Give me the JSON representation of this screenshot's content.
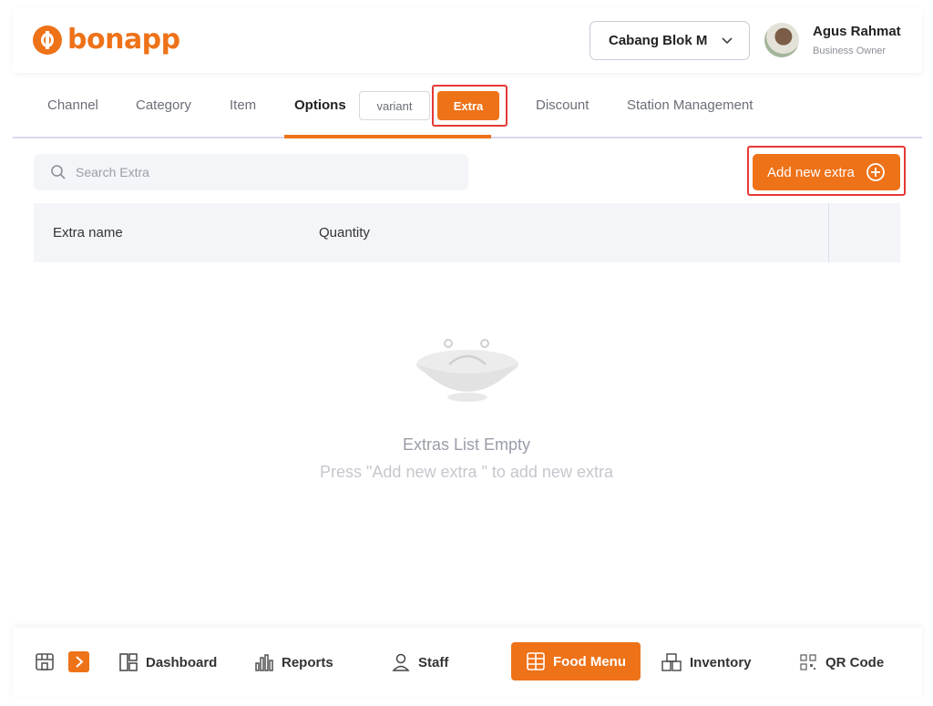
{
  "brand": {
    "name": "bonapp",
    "color": "#EE7218"
  },
  "branch": {
    "label": "Cabang Blok M"
  },
  "user": {
    "name": "Agus Rahmat",
    "role": "Business Owner"
  },
  "tabs": [
    {
      "label": "Channel",
      "active": false
    },
    {
      "label": "Category",
      "active": false
    },
    {
      "label": "Item",
      "active": false
    },
    {
      "label": "Options",
      "active": true
    },
    {
      "label": "Discount",
      "active": false
    },
    {
      "label": "Station Management",
      "active": false
    }
  ],
  "subtabs": {
    "variant": "variant",
    "extra": "Extra",
    "selected": "Extra"
  },
  "search": {
    "placeholder": "Search Extra",
    "value": ""
  },
  "add_button": {
    "label": "Add new extra"
  },
  "table": {
    "columns": [
      "Extra name",
      "Quantity"
    ]
  },
  "empty": {
    "title": "Extras List Empty",
    "subtitle": "Press \"Add new extra \" to add new extra"
  },
  "bottom_nav": [
    {
      "label": "Dashboard",
      "icon": "dashboard-icon",
      "active": false
    },
    {
      "label": "Reports",
      "icon": "reports-icon",
      "active": false
    },
    {
      "label": "Staff",
      "icon": "staff-icon",
      "active": false
    },
    {
      "label": "Food Menu",
      "icon": "food-menu-icon",
      "active": true
    },
    {
      "label": "Inventory",
      "icon": "inventory-icon",
      "active": false
    },
    {
      "label": "QR Code",
      "icon": "qr-code-icon",
      "active": false
    }
  ],
  "highlight_color": "#e53935"
}
